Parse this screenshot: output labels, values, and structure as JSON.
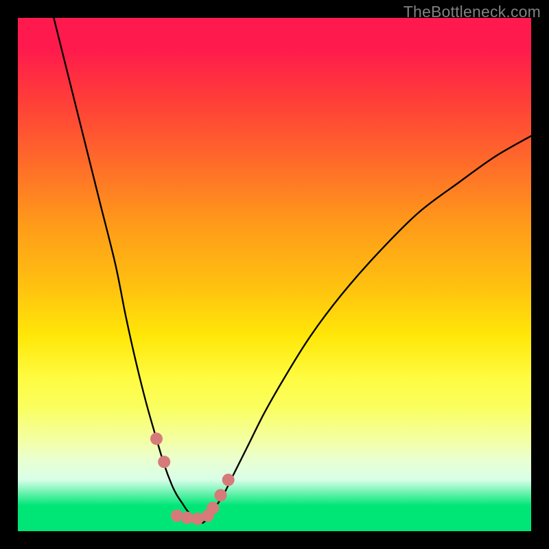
{
  "watermark": "TheBottleneck.com",
  "colors": {
    "frame": "#000000",
    "curve": "#000000",
    "markers": "#d77a7a",
    "gradient_top": "#ff1a4d",
    "gradient_bottom": "#00e676"
  },
  "chart_data": {
    "type": "line",
    "title": "",
    "xlabel": "",
    "ylabel": "",
    "xlim": [
      0,
      100
    ],
    "ylim": [
      0,
      100
    ],
    "series": [
      {
        "name": "curve-left",
        "x": [
          7,
          10,
          13,
          16,
          19,
          21,
          23,
          25,
          27,
          28.5,
          30,
          31,
          32,
          33,
          34,
          35,
          36
        ],
        "values": [
          100,
          88,
          76,
          64,
          52,
          42,
          33,
          25,
          18,
          13,
          9,
          7,
          5.5,
          4,
          3,
          2.2,
          1.6
        ]
      },
      {
        "name": "curve-right",
        "x": [
          36,
          37,
          38,
          40,
          42,
          45,
          48,
          52,
          57,
          63,
          70,
          78,
          86,
          93,
          100
        ],
        "values": [
          1.6,
          2.4,
          4,
          7,
          11,
          17,
          23,
          30,
          38,
          46,
          54,
          62,
          68,
          73,
          77
        ]
      }
    ],
    "markers": {
      "name": "highlight-dots",
      "points": [
        {
          "x": 27,
          "y": 18
        },
        {
          "x": 28.5,
          "y": 13.5
        },
        {
          "x": 31,
          "y": 3
        },
        {
          "x": 33,
          "y": 2.6
        },
        {
          "x": 35,
          "y": 2.4
        },
        {
          "x": 37,
          "y": 3
        },
        {
          "x": 38,
          "y": 4.5
        },
        {
          "x": 39.5,
          "y": 7
        },
        {
          "x": 41,
          "y": 10
        }
      ]
    }
  }
}
